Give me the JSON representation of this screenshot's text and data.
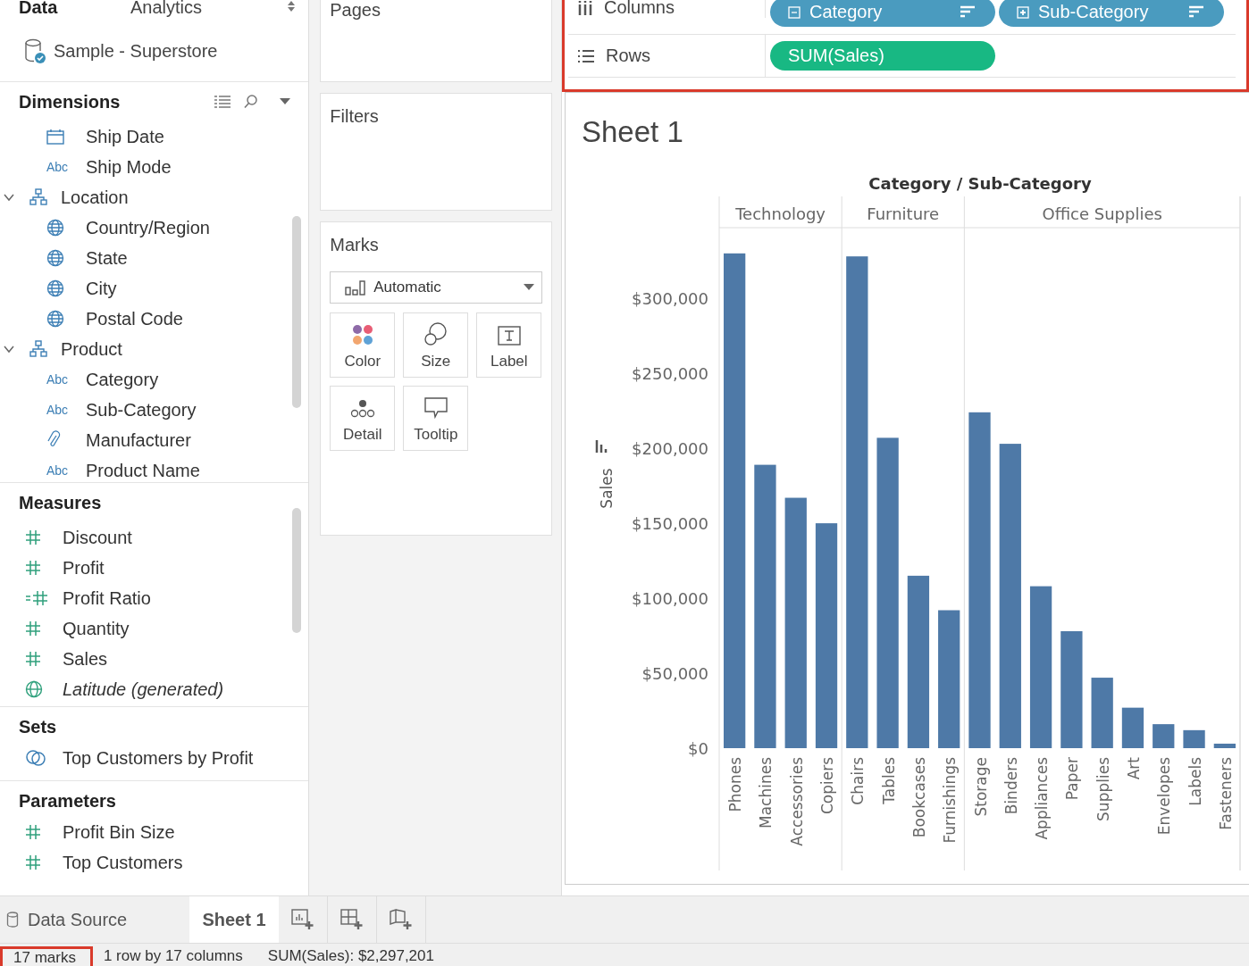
{
  "data_pane": {
    "tabs": [
      {
        "label": "Data",
        "selected": true
      },
      {
        "label": "Analytics",
        "selected": false
      }
    ],
    "data_source": "Sample - Superstore",
    "sections": [
      {
        "title": "Dimensions",
        "tools": true,
        "scrollable": true,
        "items": [
          {
            "kind": "continued",
            "children": [
              {
                "kind": "date",
                "label": "Ship Date"
              },
              {
                "kind": "text",
                "type_label": "Abc",
                "label": "Ship Mode"
              }
            ]
          },
          {
            "kind": "hierarchy",
            "label": "Location",
            "expanded": true,
            "children": [
              {
                "kind": "geo",
                "label": "Country/Region"
              },
              {
                "kind": "geo",
                "label": "State"
              },
              {
                "kind": "geo",
                "label": "City"
              },
              {
                "kind": "geo",
                "label": "Postal Code"
              }
            ]
          },
          {
            "kind": "hierarchy",
            "label": "Product",
            "expanded": true,
            "children": [
              {
                "kind": "text",
                "type_label": "Abc",
                "label": "Category"
              },
              {
                "kind": "text",
                "type_label": "Abc",
                "label": "Sub-Category"
              },
              {
                "kind": "clip",
                "label": "Manufacturer"
              },
              {
                "kind": "text",
                "type_label": "Abc",
                "label": "Product Name"
              }
            ]
          }
        ]
      },
      {
        "title": "Measures",
        "tools": false,
        "scrollable": true,
        "items": [
          {
            "kind": "number",
            "label": "Discount"
          },
          {
            "kind": "number",
            "label": "Profit"
          },
          {
            "kind": "calc-number",
            "label": "Profit Ratio"
          },
          {
            "kind": "number",
            "label": "Quantity"
          },
          {
            "kind": "number",
            "label": "Sales"
          },
          {
            "kind": "geo",
            "label": "Latitude (generated)",
            "generated": true
          }
        ]
      },
      {
        "title": "Sets",
        "tools": false,
        "scrollable": false,
        "items": [
          {
            "kind": "set",
            "label": "Top Customers by Profit"
          }
        ]
      },
      {
        "title": "Parameters",
        "tools": false,
        "scrollable": false,
        "items": [
          {
            "kind": "number",
            "label": "Profit Bin Size"
          },
          {
            "kind": "number",
            "label": "Top Customers"
          }
        ]
      }
    ]
  },
  "pages": {
    "title": "Pages"
  },
  "filters": {
    "title": "Filters"
  },
  "marks": {
    "title": "Marks",
    "mark_type": "Automatic",
    "cards": [
      {
        "kind": "color",
        "label": "Color"
      },
      {
        "kind": "size",
        "label": "Size"
      },
      {
        "kind": "label",
        "label": "Label"
      },
      {
        "kind": "detail",
        "label": "Detail"
      },
      {
        "kind": "tooltip",
        "label": "Tooltip"
      }
    ]
  },
  "shelves": {
    "highlighted": true,
    "rows": [
      {
        "kind": "columns",
        "label": "Columns",
        "pills": [
          {
            "kind": "dimension",
            "label": "Category",
            "expanded": true,
            "sorted": true
          },
          {
            "kind": "dimension",
            "label": "Sub-Category",
            "expanded": false,
            "sorted": true
          }
        ]
      },
      {
        "kind": "rows",
        "label": "Rows",
        "pills": [
          {
            "kind": "measure",
            "label": "SUM(Sales)",
            "sorted": false
          }
        ]
      }
    ]
  },
  "sheet": {
    "title": "Sheet 1",
    "chart_data": {
      "type": "bar",
      "xlabel": "Category / Sub-Category",
      "ylabel": "Sales",
      "categories": [
        "Phones",
        "Machines",
        "Accessories",
        "Copiers",
        "Chairs",
        "Tables",
        "Bookcases",
        "Furnishings",
        "Storage",
        "Binders",
        "Appliances",
        "Paper",
        "Supplies",
        "Art",
        "Envelopes",
        "Labels",
        "Fasteners"
      ],
      "series": [
        {
          "color": "#4e79a7",
          "values": [
            330000,
            189000,
            167000,
            150000,
            328000,
            207000,
            115000,
            92000,
            224000,
            203000,
            108000,
            78000,
            47000,
            27000,
            16000,
            12000,
            3000
          ]
        }
      ],
      "ylim": [
        0,
        368000
      ],
      "yticks": [
        {
          "value": 0,
          "label": "$0"
        },
        {
          "value": 50000,
          "label": "$50,000"
        },
        {
          "value": 100000,
          "label": "$100,000"
        },
        {
          "value": 150000,
          "label": "$150,000"
        },
        {
          "value": 200000,
          "label": "$200,000"
        },
        {
          "value": 250000,
          "label": "$250,000"
        },
        {
          "value": 300000,
          "label": "$300,000"
        }
      ],
      "annotations": [
        "Technology",
        "Furniture",
        "Office Supplies"
      ]
    }
  },
  "sheet_tabs": {
    "data_source": "Data Source",
    "sheets": [
      {
        "label": "Sheet 1",
        "selected": true
      }
    ],
    "new_buttons": [
      {
        "kind": "worksheet"
      },
      {
        "kind": "dashboard"
      },
      {
        "kind": "story"
      }
    ]
  },
  "status_bar": [
    {
      "text": "17 marks",
      "highlighted": true
    },
    {
      "text": "1 row by 17 columns",
      "highlighted": false
    },
    {
      "text": "SUM(Sales): $2,297,201",
      "highlighted": false
    }
  ]
}
